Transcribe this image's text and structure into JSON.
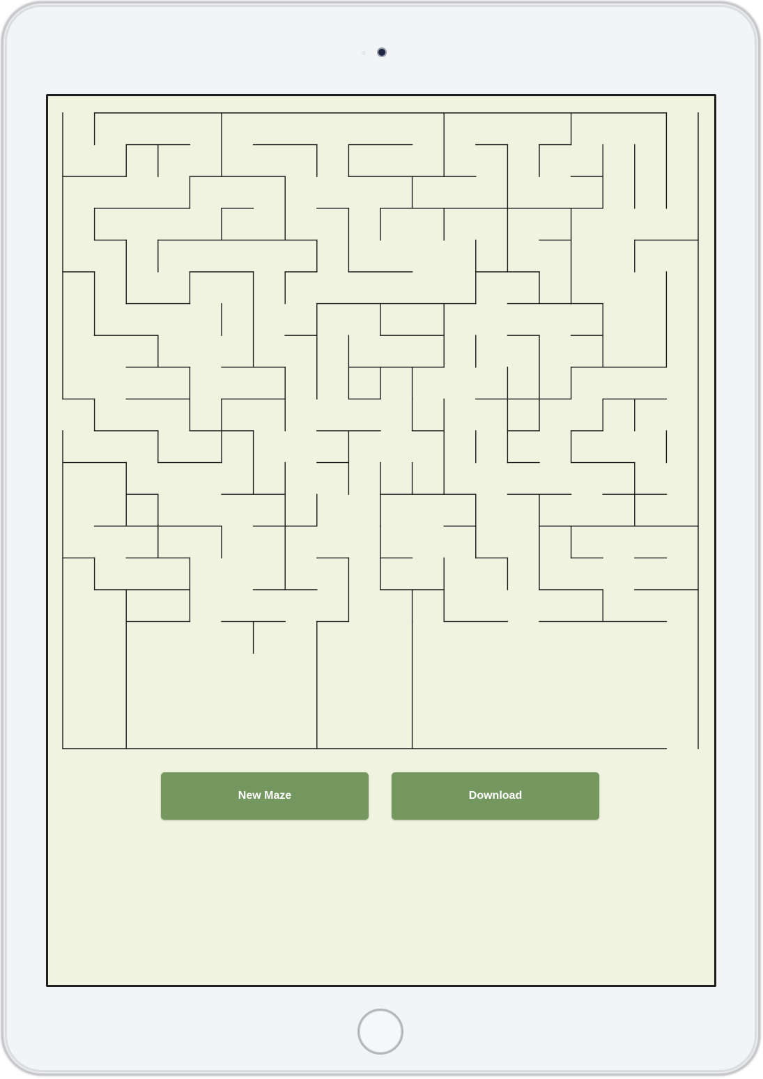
{
  "toolbar": {
    "new_maze_label": "New Maze",
    "download_label": "Download"
  },
  "colors": {
    "screen_background": "#f0f3df",
    "button": "#73975e",
    "button_text": "#ffffff",
    "maze_wall": "#1a1a1a"
  },
  "maze": {
    "columns": 20,
    "rows": 20
  }
}
